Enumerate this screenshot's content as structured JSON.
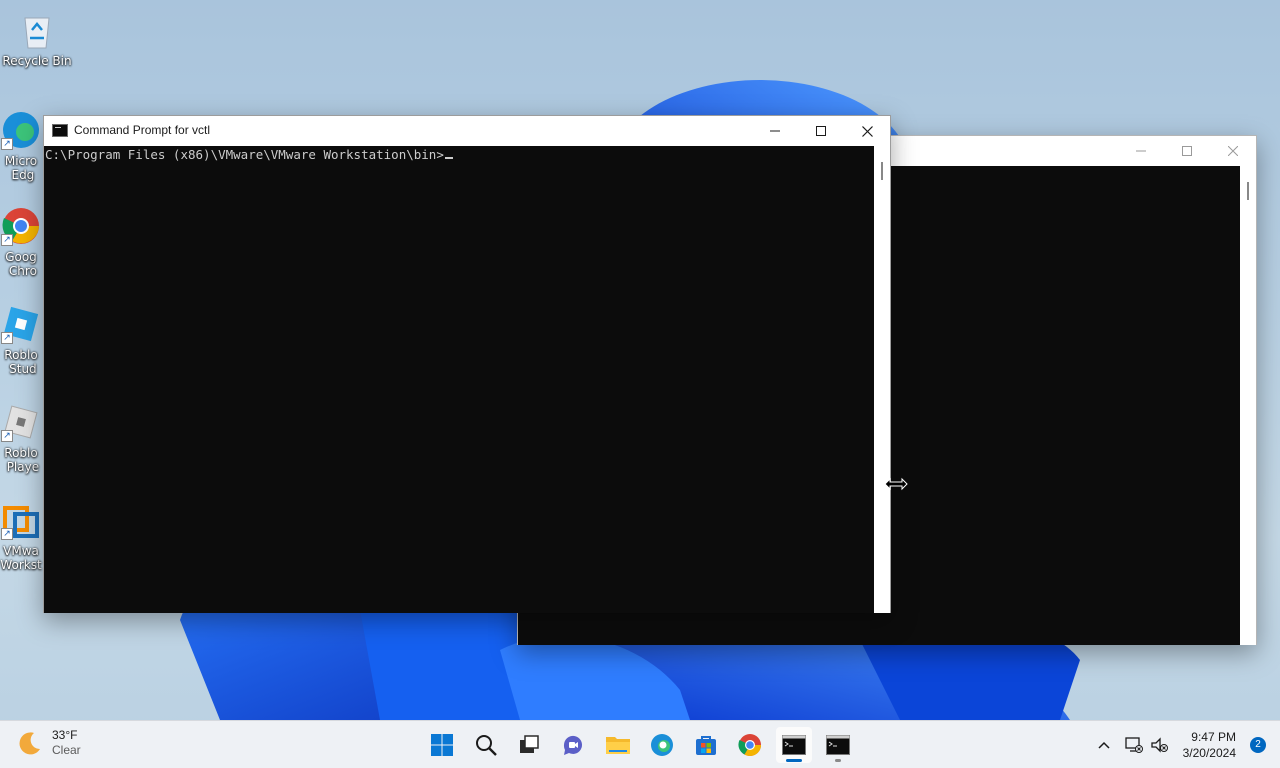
{
  "desktop": {
    "icons": [
      {
        "label": "Recycle Bin",
        "icon": "recycle-bin-icon"
      },
      {
        "label": "Micro\nEdg",
        "icon": "edge-icon"
      },
      {
        "label": "Goog\nChro",
        "icon": "chrome-icon"
      },
      {
        "label": "Roblo\nStud",
        "icon": "roblox-studio-icon"
      },
      {
        "label": "Roblo\nPlaye",
        "icon": "roblox-player-icon"
      },
      {
        "label": "VMwa\nWorkst",
        "icon": "vmware-icon"
      }
    ]
  },
  "front_window": {
    "title": "Command Prompt for vctl",
    "console_line": "C:\\Program Files (x86)\\VMware\\VMware Workstation\\bin>"
  },
  "back_window": {
    "title": ""
  },
  "taskbar": {
    "weather": {
      "temp": "33°F",
      "condition": "Clear",
      "icon": "moon-icon"
    },
    "apps": [
      {
        "name": "Start",
        "icon": "windows-start-icon"
      },
      {
        "name": "Search",
        "icon": "search-icon"
      },
      {
        "name": "Task View",
        "icon": "task-view-icon"
      },
      {
        "name": "Chat",
        "icon": "chat-icon"
      },
      {
        "name": "File Explorer",
        "icon": "folder-icon"
      },
      {
        "name": "Microsoft Edge",
        "icon": "edge-icon"
      },
      {
        "name": "Microsoft Store",
        "icon": "store-icon"
      },
      {
        "name": "Google Chrome",
        "icon": "chrome-icon"
      },
      {
        "name": "Command Prompt for vctl",
        "icon": "cmd-icon"
      },
      {
        "name": "Command Prompt",
        "icon": "cmd-icon"
      }
    ],
    "clock": {
      "time": "9:47 PM",
      "date": "3/20/2024"
    },
    "notification_count": "2"
  },
  "colors": {
    "accent": "#0067c0",
    "console_bg": "#0c0c0c",
    "console_fg": "#cccccc"
  }
}
